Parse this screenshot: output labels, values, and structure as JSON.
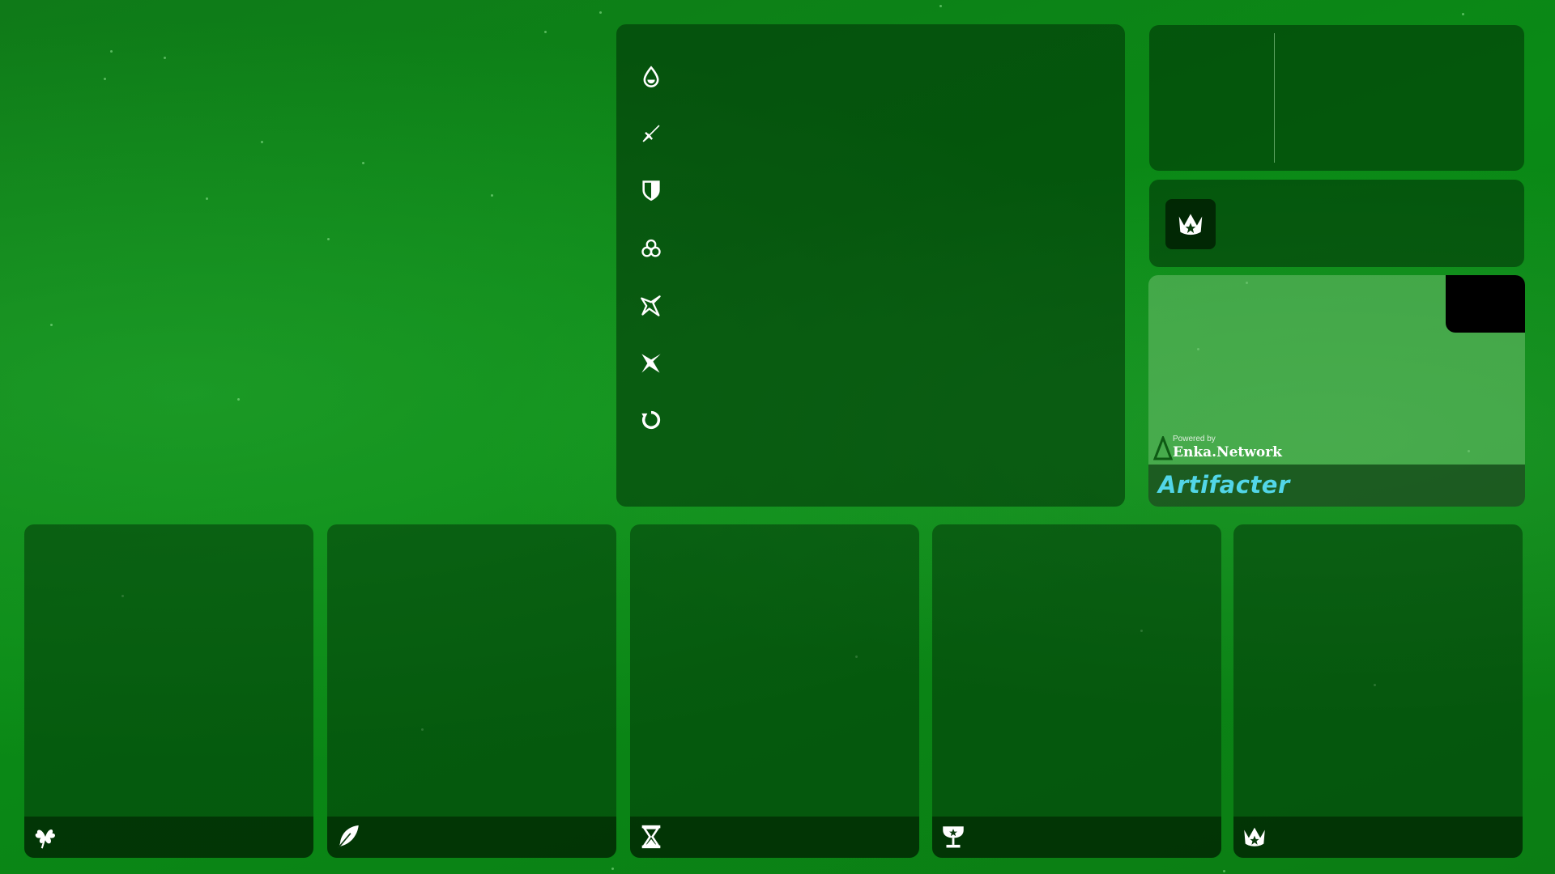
{
  "weapon_card": {
    "powered_by": "Powered by",
    "provider": "Enka.Network",
    "brand": "Artifacter"
  },
  "stats_icons": [
    "hp-drop-icon",
    "atk-sword-icon",
    "def-shield-icon",
    "elemental-mastery-icon",
    "crit-rate-icon",
    "crit-dmg-icon",
    "energy-recharge-icon"
  ],
  "constellation_icon": "crown-icon",
  "artifact_slots": [
    {
      "slot": "flower",
      "icon": "flower-icon"
    },
    {
      "slot": "plume",
      "icon": "feather-icon"
    },
    {
      "slot": "sands",
      "icon": "hourglass-icon"
    },
    {
      "slot": "goblet",
      "icon": "goblet-icon"
    },
    {
      "slot": "circlet",
      "icon": "crown-icon"
    }
  ],
  "colors": {
    "background": "#0a8a16",
    "panel": "#003205",
    "brand_text": "#52d6e8"
  }
}
